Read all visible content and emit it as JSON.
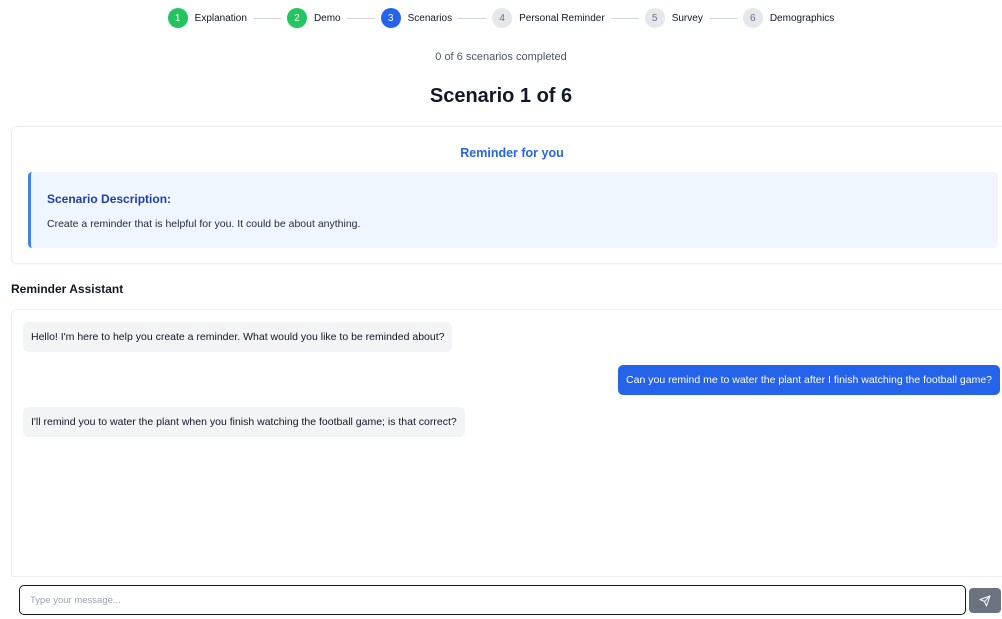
{
  "stepper": {
    "steps": [
      {
        "number": "1",
        "label": "Explanation",
        "state": "done"
      },
      {
        "number": "2",
        "label": "Demo",
        "state": "done"
      },
      {
        "number": "3",
        "label": "Scenarios",
        "state": "current"
      },
      {
        "number": "4",
        "label": "Personal Reminder",
        "state": "todo"
      },
      {
        "number": "5",
        "label": "Survey",
        "state": "todo"
      },
      {
        "number": "6",
        "label": "Demographics",
        "state": "todo"
      }
    ]
  },
  "progress": {
    "text": "0 of 6 scenarios completed"
  },
  "scenario": {
    "title": "Scenario 1 of 6",
    "card_title": "Reminder for you",
    "description_heading": "Scenario Description:",
    "description_text": "Create a reminder that is helpful for you. It could be about anything."
  },
  "assistant": {
    "heading": "Reminder Assistant",
    "messages": [
      {
        "role": "assistant",
        "text": "Hello! I'm here to help you create a reminder. What would you like to be reminded about?"
      },
      {
        "role": "user",
        "text": "Can you remind me to water the plant after I finish watching the football game?"
      },
      {
        "role": "assistant",
        "text": "I'll remind you to water the plant when you finish watching the football game; is that correct?"
      }
    ]
  },
  "composer": {
    "placeholder": "Type your message...",
    "value": "",
    "send_icon": "send-icon"
  },
  "colors": {
    "done": "#22c55e",
    "current": "#2563eb",
    "todo": "#e5e7eb",
    "user_bubble": "#2563eb",
    "bot_bubble": "#f3f4f6",
    "send_button": "#6b7280"
  }
}
